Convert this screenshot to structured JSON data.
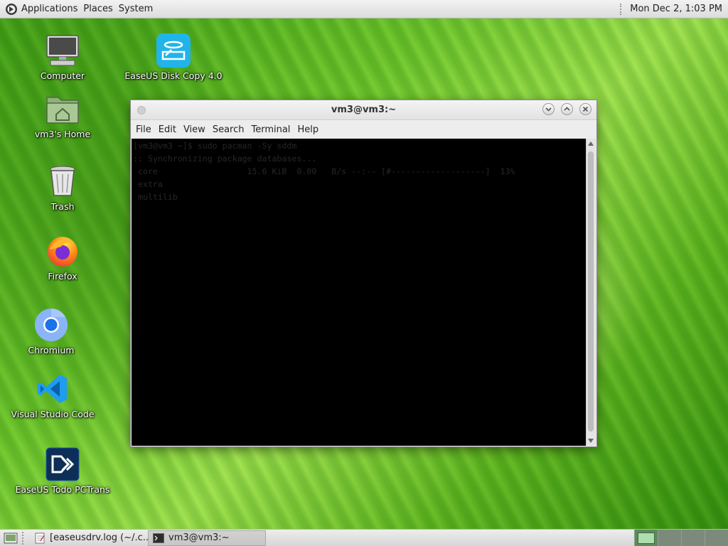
{
  "top_panel": {
    "menus": [
      "Applications",
      "Places",
      "System"
    ],
    "clock": "Mon Dec  2,  1:03 PM"
  },
  "desktop_icons": [
    {
      "label": "Computer",
      "icon": "computer-icon"
    },
    {
      "label": "EaseUS Disk Copy 4.0",
      "icon": "easeus-disk-copy-icon"
    },
    {
      "label": "vm3's Home",
      "icon": "home-folder-icon"
    },
    {
      "label": "Trash",
      "icon": "trash-icon"
    },
    {
      "label": "Firefox",
      "icon": "firefox-icon"
    },
    {
      "label": "Chromium",
      "icon": "chromium-icon"
    },
    {
      "label": "Visual Studio Code",
      "icon": "vscode-icon"
    },
    {
      "label": "EaseUS Todo PCTrans",
      "icon": "easeus-todo-pctrans-icon"
    }
  ],
  "terminal": {
    "title": "vm3@vm3:~",
    "menu": [
      "File",
      "Edit",
      "View",
      "Search",
      "Terminal",
      "Help"
    ],
    "lines": [
      "[vm3@vm3 ~]$ sudo pacman -Sy sddm",
      ":: Synchronizing package databases...",
      " core                  15.6 KiB  0.00   B/s --:-- [#-------------------]  13%",
      " extra",
      " multilib"
    ]
  },
  "taskbar": {
    "tasks": [
      {
        "label": "[easeusdrv.log (~/.c...",
        "icon": "text-editor-icon",
        "active": false
      },
      {
        "label": "vm3@vm3:~",
        "icon": "terminal-icon",
        "active": true
      }
    ],
    "workspaces": 4,
    "active_workspace": 1
  }
}
